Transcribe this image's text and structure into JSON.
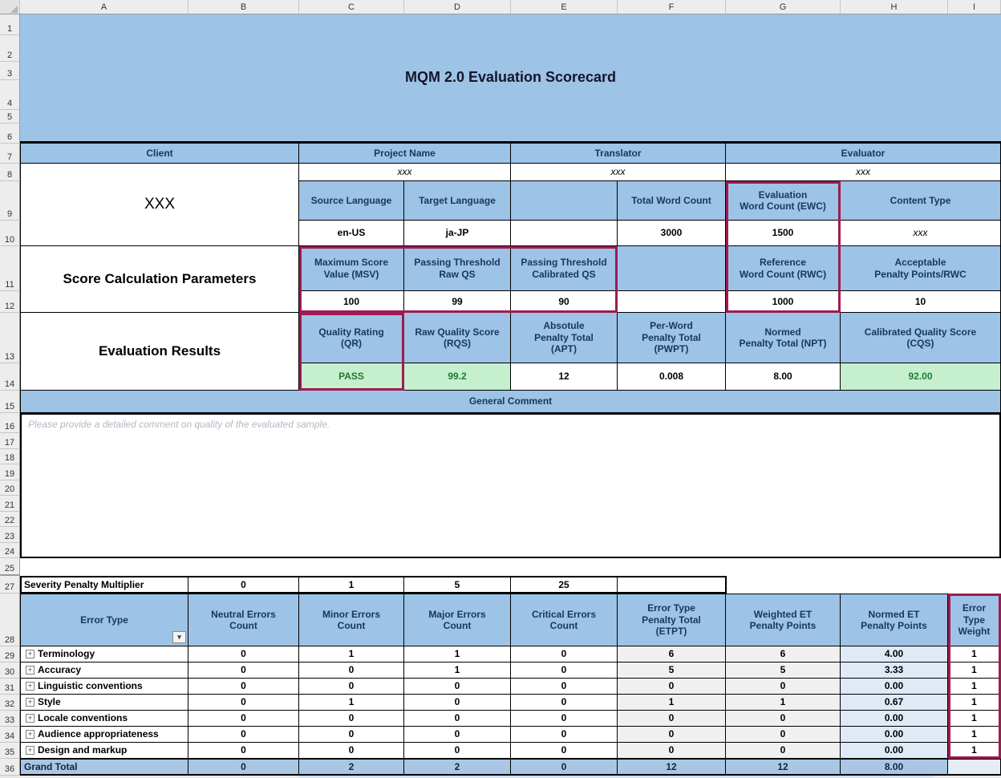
{
  "sheet": {
    "columns": [
      "A",
      "B",
      "C",
      "D",
      "E",
      "F",
      "G",
      "H",
      "I"
    ],
    "rows": [
      "1",
      "2",
      "3",
      "4",
      "5",
      "6",
      "7",
      "8",
      "9",
      "10",
      "11",
      "12",
      "13",
      "14",
      "15",
      "16",
      "17",
      "18",
      "19",
      "20",
      "21",
      "22",
      "23",
      "24",
      "25",
      "27",
      "28",
      "29",
      "30",
      "31",
      "32",
      "33",
      "34",
      "35",
      "36"
    ]
  },
  "title": "MQM 2.0 Evaluation Scorecard",
  "meta": {
    "client_label": "Client",
    "client_value": "XXX",
    "project_label": "Project Name",
    "project_value": "xxx",
    "translator_label": "Translator",
    "translator_value": "xxx",
    "evaluator_label": "Evaluator",
    "evaluator_value": "xxx",
    "source_lang_label": "Source Language",
    "source_lang_value": "en-US",
    "target_lang_label": "Target Language",
    "target_lang_value": "ja-JP",
    "total_wc_label": "Total Word Count",
    "total_wc_value": "3000",
    "ewc_label": "Evaluation\nWord Count (EWC)",
    "ewc_value": "1500",
    "content_type_label": "Content Type",
    "content_type_value": "xxx"
  },
  "params": {
    "section_label": "Score Calculation Parameters",
    "msv_label": "Maximum Score\nValue (MSV)",
    "msv_value": "100",
    "ptraw_label": "Passing Threshold\nRaw QS",
    "ptraw_value": "99",
    "ptcal_label": "Passing Threshold\nCalibrated QS",
    "ptcal_value": "90",
    "rwc_label": "Reference\nWord Count (RWC)",
    "rwc_value": "1000",
    "app_label": "Acceptable\nPenalty Points/RWC",
    "app_value": "10"
  },
  "results": {
    "section_label": "Evaluation Results",
    "qr_label": "Quality Rating\n(QR)",
    "qr_value": "PASS",
    "rqs_label": "Raw Quality Score\n(RQS)",
    "rqs_value": "99.2",
    "apt_label": "Absotule\nPenalty Total\n(APT)",
    "apt_value": "12",
    "pwpt_label": "Per-Word\nPenalty Total\n(PWPT)",
    "pwpt_value": "0.008",
    "npt_label": "Normed\nPenalty Total (NPT)",
    "npt_value": "8.00",
    "cqs_label": "Calibrated Quality Score\n(CQS)",
    "cqs_value": "92.00"
  },
  "comment": {
    "header": "General Comment",
    "placeholder": "Please provide a detailed comment on quality of the evaluated sample."
  },
  "severity": {
    "label": "Severity Penalty Multiplier",
    "neutral": "0",
    "minor": "1",
    "major": "5",
    "critical": "25"
  },
  "error_table": {
    "headers": {
      "error_type": "Error Type",
      "neutral": "Neutral Errors\nCount",
      "minor": "Minor Errors\nCount",
      "major": "Major Errors\nCount",
      "critical": "Critical Errors\nCount",
      "etpt": "Error Type\nPenalty Total\n(ETPT)",
      "weighted": "Weighted ET\nPenalty Points",
      "normed": "Normed ET\nPenalty Points",
      "weight": "Error\nType\nWeight"
    },
    "rows": [
      {
        "label": "Terminology",
        "neutral": "0",
        "minor": "1",
        "major": "1",
        "critical": "0",
        "etpt": "6",
        "weighted": "6",
        "normed": "4.00",
        "weight": "1"
      },
      {
        "label": "Accuracy",
        "neutral": "0",
        "minor": "0",
        "major": "1",
        "critical": "0",
        "etpt": "5",
        "weighted": "5",
        "normed": "3.33",
        "weight": "1"
      },
      {
        "label": "Linguistic conventions",
        "neutral": "0",
        "minor": "0",
        "major": "0",
        "critical": "0",
        "etpt": "0",
        "weighted": "0",
        "normed": "0.00",
        "weight": "1"
      },
      {
        "label": "Style",
        "neutral": "0",
        "minor": "1",
        "major": "0",
        "critical": "0",
        "etpt": "1",
        "weighted": "1",
        "normed": "0.67",
        "weight": "1"
      },
      {
        "label": "Locale conventions",
        "neutral": "0",
        "minor": "0",
        "major": "0",
        "critical": "0",
        "etpt": "0",
        "weighted": "0",
        "normed": "0.00",
        "weight": "1"
      },
      {
        "label": "Audience appropriateness",
        "neutral": "0",
        "minor": "0",
        "major": "0",
        "critical": "0",
        "etpt": "0",
        "weighted": "0",
        "normed": "0.00",
        "weight": "1"
      },
      {
        "label": "Design and markup",
        "neutral": "0",
        "minor": "0",
        "major": "0",
        "critical": "0",
        "etpt": "0",
        "weighted": "0",
        "normed": "0.00",
        "weight": "1"
      }
    ],
    "grand_total": {
      "label": "Grand Total",
      "neutral": "0",
      "minor": "2",
      "major": "2",
      "critical": "0",
      "etpt": "12",
      "weighted": "12",
      "normed": "8.00"
    }
  },
  "colors": {
    "header_blue": "#9DC3E6",
    "good_green_bg": "#C6EFCE",
    "good_green_text": "#1E7B34",
    "highlight_border": "#9E1B52",
    "grand_total_bg": "#A9C7E4"
  }
}
